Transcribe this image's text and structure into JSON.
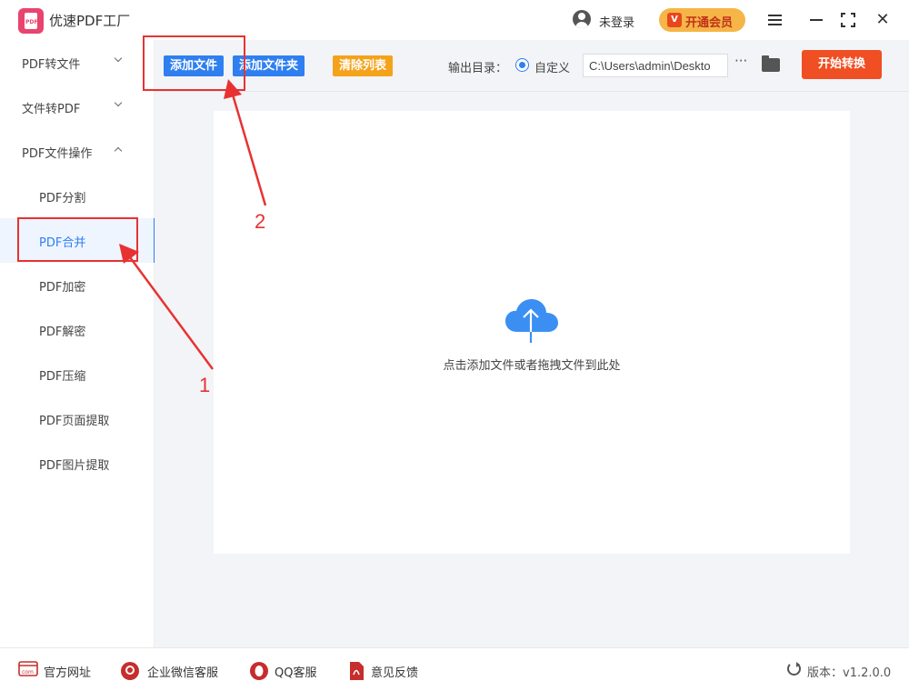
{
  "app": {
    "title": "优速PDF工厂",
    "logo_text": "PDF"
  },
  "header": {
    "login_text": "未登录",
    "vip_label": "开通会员",
    "vip_icon_text": "V",
    "close_glyph": "✕"
  },
  "sidebar": {
    "items": [
      {
        "label": "PDF转文件"
      },
      {
        "label": "文件转PDF"
      },
      {
        "label": "PDF文件操作"
      },
      {
        "label": "PDF分割"
      },
      {
        "label": "PDF合并"
      },
      {
        "label": "PDF加密"
      },
      {
        "label": "PDF解密"
      },
      {
        "label": "PDF压缩"
      },
      {
        "label": "PDF页面提取"
      },
      {
        "label": "PDF图片提取"
      }
    ],
    "active": "PDF合并"
  },
  "toolbar": {
    "add_file": "添加文件",
    "add_folder": "添加文件夹",
    "clear_list": "清除列表",
    "output_label": "输出目录：",
    "radio_label": "自定义",
    "output_path": "C:\\Users\\admin\\Deskto",
    "more_glyph": "···",
    "start": "开始转换"
  },
  "dropzone": {
    "hint": "点击添加文件或者拖拽文件到此处"
  },
  "footer": {
    "website": "官方网址",
    "wechat": "企业微信客服",
    "qq": "QQ客服",
    "feedback": "意见反馈",
    "version": "版本：v1.2.0.0"
  },
  "annotations": {
    "step1": "1",
    "step2": "2"
  },
  "colors": {
    "accent": "#2f7ff0",
    "start": "#f04e23",
    "clear": "#f5a21b",
    "annotation": "#e83232"
  }
}
